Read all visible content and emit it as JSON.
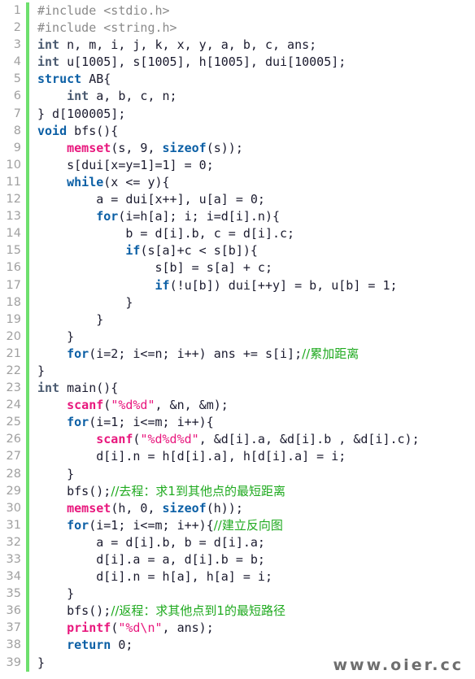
{
  "viewer": {
    "language": "C",
    "total_lines": 39,
    "gutter_marker_color": "#6ee06e",
    "background_color": "#ffffff",
    "colors": {
      "keyword": "#0b5fa5",
      "function": "#e8177d",
      "string": "#e8177d",
      "comment": "#1faa1f",
      "preprocessor": "#8a8a8a",
      "type": "#4a5a70",
      "plain": "#1b1b2f",
      "line_number": "#a0a0a0",
      "watermark": "#6e6e6e"
    }
  },
  "watermark": {
    "text": "www.oier.cc"
  },
  "line_numbers": [
    "1",
    "2",
    "3",
    "4",
    "5",
    "6",
    "7",
    "8",
    "9",
    "10",
    "11",
    "12",
    "13",
    "14",
    "15",
    "16",
    "17",
    "18",
    "19",
    "20",
    "21",
    "22",
    "23",
    "24",
    "25",
    "26",
    "27",
    "28",
    "29",
    "30",
    "31",
    "32",
    "33",
    "34",
    "35",
    "36",
    "37",
    "38",
    "39"
  ],
  "lines": [
    {
      "n": "1",
      "plain": "#include <stdio.h>",
      "tokens": [
        {
          "t": "pp",
          "v": "#include <stdio.h>"
        }
      ]
    },
    {
      "n": "2",
      "plain": "#include <string.h>",
      "tokens": [
        {
          "t": "pp",
          "v": "#include <string.h>"
        }
      ]
    },
    {
      "n": "3",
      "plain": "int n, m, i, j, k, x, y, a, b, c, ans;",
      "tokens": [
        {
          "t": "ty",
          "v": "int"
        },
        {
          "t": "pl",
          "v": " n, m, i, j, k, x, y, a, b, c, ans;"
        }
      ]
    },
    {
      "n": "4",
      "plain": "int u[1005], s[1005], h[1005], dui[10005];",
      "tokens": [
        {
          "t": "ty",
          "v": "int"
        },
        {
          "t": "pl",
          "v": " u[1005], s[1005], h[1005], dui[10005];"
        }
      ]
    },
    {
      "n": "5",
      "plain": "struct AB{",
      "tokens": [
        {
          "t": "kw",
          "v": "struct"
        },
        {
          "t": "pl",
          "v": " AB{"
        }
      ]
    },
    {
      "n": "6",
      "plain": "    int a, b, c, n;",
      "tokens": [
        {
          "t": "pl",
          "v": "    "
        },
        {
          "t": "ty",
          "v": "int"
        },
        {
          "t": "pl",
          "v": " a, b, c, n;"
        }
      ]
    },
    {
      "n": "7",
      "plain": "} d[100005];",
      "tokens": [
        {
          "t": "pl",
          "v": "} d[100005];"
        }
      ]
    },
    {
      "n": "8",
      "plain": "void bfs(){",
      "tokens": [
        {
          "t": "kw",
          "v": "void"
        },
        {
          "t": "pl",
          "v": " bfs(){"
        }
      ]
    },
    {
      "n": "9",
      "plain": "    memset(s, 9, sizeof(s));",
      "tokens": [
        {
          "t": "pl",
          "v": "    "
        },
        {
          "t": "fn",
          "v": "memset"
        },
        {
          "t": "pl",
          "v": "(s, 9, "
        },
        {
          "t": "kw",
          "v": "sizeof"
        },
        {
          "t": "pl",
          "v": "(s));"
        }
      ]
    },
    {
      "n": "10",
      "plain": "    s[dui[x=y=1]=1] = 0;",
      "tokens": [
        {
          "t": "pl",
          "v": "    s[dui[x=y=1]=1] = 0;"
        }
      ]
    },
    {
      "n": "11",
      "plain": "    while(x <= y){",
      "tokens": [
        {
          "t": "pl",
          "v": "    "
        },
        {
          "t": "kw",
          "v": "while"
        },
        {
          "t": "pl",
          "v": "(x <= y){"
        }
      ]
    },
    {
      "n": "12",
      "plain": "        a = dui[x++], u[a] = 0;",
      "tokens": [
        {
          "t": "pl",
          "v": "        a = dui[x++], u[a] = 0;"
        }
      ]
    },
    {
      "n": "13",
      "plain": "        for(i=h[a]; i; i=d[i].n){",
      "tokens": [
        {
          "t": "pl",
          "v": "        "
        },
        {
          "t": "kw",
          "v": "for"
        },
        {
          "t": "pl",
          "v": "(i=h[a]; i; i=d[i].n){"
        }
      ]
    },
    {
      "n": "14",
      "plain": "            b = d[i].b, c = d[i].c;",
      "tokens": [
        {
          "t": "pl",
          "v": "            b = d[i].b, c = d[i].c;"
        }
      ]
    },
    {
      "n": "15",
      "plain": "            if(s[a]+c < s[b]){",
      "tokens": [
        {
          "t": "pl",
          "v": "            "
        },
        {
          "t": "kw",
          "v": "if"
        },
        {
          "t": "pl",
          "v": "(s[a]+c < s[b]){"
        }
      ]
    },
    {
      "n": "16",
      "plain": "                s[b] = s[a] + c;",
      "tokens": [
        {
          "t": "pl",
          "v": "                s[b] = s[a] + c;"
        }
      ]
    },
    {
      "n": "17",
      "plain": "                if(!u[b]) dui[++y] = b, u[b] = 1;",
      "tokens": [
        {
          "t": "pl",
          "v": "                "
        },
        {
          "t": "kw",
          "v": "if"
        },
        {
          "t": "pl",
          "v": "(!u[b]) dui[++y] = b, u[b] = 1;"
        }
      ]
    },
    {
      "n": "18",
      "plain": "            }",
      "tokens": [
        {
          "t": "pl",
          "v": "            }"
        }
      ]
    },
    {
      "n": "19",
      "plain": "        }",
      "tokens": [
        {
          "t": "pl",
          "v": "        }"
        }
      ]
    },
    {
      "n": "20",
      "plain": "    }",
      "tokens": [
        {
          "t": "pl",
          "v": "    }"
        }
      ]
    },
    {
      "n": "21",
      "plain": "    for(i=2; i<=n; i++) ans += s[i];//累加距离",
      "tokens": [
        {
          "t": "pl",
          "v": "    "
        },
        {
          "t": "kw",
          "v": "for"
        },
        {
          "t": "pl",
          "v": "(i=2; i<=n; i++) ans += s[i];"
        },
        {
          "t": "cm",
          "v": "//累加距离"
        }
      ]
    },
    {
      "n": "22",
      "plain": "}",
      "tokens": [
        {
          "t": "pl",
          "v": "}"
        }
      ]
    },
    {
      "n": "23",
      "plain": "int main(){",
      "tokens": [
        {
          "t": "ty",
          "v": "int"
        },
        {
          "t": "pl",
          "v": " main(){"
        }
      ]
    },
    {
      "n": "24",
      "plain": "    scanf(\"%d%d\", &n, &m);",
      "tokens": [
        {
          "t": "pl",
          "v": "    "
        },
        {
          "t": "fn",
          "v": "scanf"
        },
        {
          "t": "pl",
          "v": "("
        },
        {
          "t": "str",
          "v": "\"%d%d\""
        },
        {
          "t": "pl",
          "v": ", &n, &m);"
        }
      ]
    },
    {
      "n": "25",
      "plain": "    for(i=1; i<=m; i++){",
      "tokens": [
        {
          "t": "pl",
          "v": "    "
        },
        {
          "t": "kw",
          "v": "for"
        },
        {
          "t": "pl",
          "v": "(i=1; i<=m; i++){"
        }
      ]
    },
    {
      "n": "26",
      "plain": "        scanf(\"%d%d%d\", &d[i].a, &d[i].b , &d[i].c);",
      "tokens": [
        {
          "t": "pl",
          "v": "        "
        },
        {
          "t": "fn",
          "v": "scanf"
        },
        {
          "t": "pl",
          "v": "("
        },
        {
          "t": "str",
          "v": "\"%d%d%d\""
        },
        {
          "t": "pl",
          "v": ", &d[i].a, &d[i].b , &d[i].c);"
        }
      ]
    },
    {
      "n": "27",
      "plain": "        d[i].n = h[d[i].a], h[d[i].a] = i;",
      "tokens": [
        {
          "t": "pl",
          "v": "        d[i].n = h[d[i].a], h[d[i].a] = i;"
        }
      ]
    },
    {
      "n": "28",
      "plain": "    }",
      "tokens": [
        {
          "t": "pl",
          "v": "    }"
        }
      ]
    },
    {
      "n": "29",
      "plain": "    bfs();//去程：求1到其他点的最短距离",
      "tokens": [
        {
          "t": "pl",
          "v": "    bfs();"
        },
        {
          "t": "cm",
          "v": "//去程：求1到其他点的最短距离"
        }
      ]
    },
    {
      "n": "30",
      "plain": "    memset(h, 0, sizeof(h));",
      "tokens": [
        {
          "t": "pl",
          "v": "    "
        },
        {
          "t": "fn",
          "v": "memset"
        },
        {
          "t": "pl",
          "v": "(h, 0, "
        },
        {
          "t": "kw",
          "v": "sizeof"
        },
        {
          "t": "pl",
          "v": "(h));"
        }
      ]
    },
    {
      "n": "31",
      "plain": "    for(i=1; i<=m; i++){//建立反向图",
      "tokens": [
        {
          "t": "pl",
          "v": "    "
        },
        {
          "t": "kw",
          "v": "for"
        },
        {
          "t": "pl",
          "v": "(i=1; i<=m; i++){"
        },
        {
          "t": "cm",
          "v": "//建立反向图"
        }
      ]
    },
    {
      "n": "32",
      "plain": "        a = d[i].b, b = d[i].a;",
      "tokens": [
        {
          "t": "pl",
          "v": "        a = d[i].b, b = d[i].a;"
        }
      ]
    },
    {
      "n": "33",
      "plain": "        d[i].a = a, d[i].b = b;",
      "tokens": [
        {
          "t": "pl",
          "v": "        d[i].a = a, d[i].b = b;"
        }
      ]
    },
    {
      "n": "34",
      "plain": "        d[i].n = h[a], h[a] = i;",
      "tokens": [
        {
          "t": "pl",
          "v": "        d[i].n = h[a], h[a] = i;"
        }
      ]
    },
    {
      "n": "35",
      "plain": "    }",
      "tokens": [
        {
          "t": "pl",
          "v": "    }"
        }
      ]
    },
    {
      "n": "36",
      "plain": "    bfs();//返程：求其他点到1的最短路径",
      "tokens": [
        {
          "t": "pl",
          "v": "    bfs();"
        },
        {
          "t": "cm",
          "v": "//返程：求其他点到1的最短路径"
        }
      ]
    },
    {
      "n": "37",
      "plain": "    printf(\"%d\\n\", ans);",
      "tokens": [
        {
          "t": "pl",
          "v": "    "
        },
        {
          "t": "fn",
          "v": "printf"
        },
        {
          "t": "pl",
          "v": "("
        },
        {
          "t": "str",
          "v": "\"%d\\n\""
        },
        {
          "t": "pl",
          "v": ", ans);"
        }
      ]
    },
    {
      "n": "38",
      "plain": "    return 0;",
      "tokens": [
        {
          "t": "pl",
          "v": "    "
        },
        {
          "t": "kw",
          "v": "return"
        },
        {
          "t": "pl",
          "v": " 0;"
        }
      ]
    },
    {
      "n": "39",
      "plain": "}",
      "tokens": [
        {
          "t": "pl",
          "v": "}"
        }
      ]
    }
  ]
}
